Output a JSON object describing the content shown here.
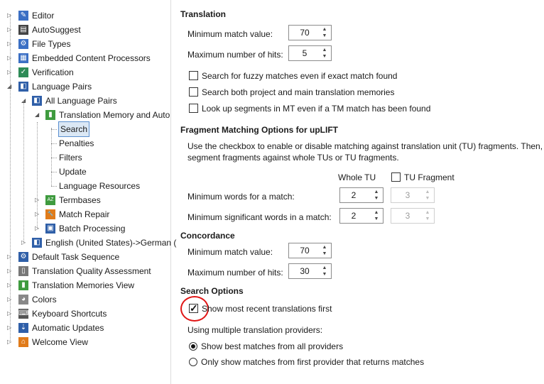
{
  "tree": {
    "items": [
      {
        "label": "Editor",
        "icon": "pencil-icon",
        "color": "#3b6fc4",
        "glyph": "✎"
      },
      {
        "label": "AutoSuggest",
        "icon": "autosuggest-icon",
        "color": "#444444",
        "glyph": "▤"
      },
      {
        "label": "File Types",
        "icon": "file-types-icon",
        "color": "#3b6fc4",
        "glyph": "⚙"
      },
      {
        "label": "Embedded Content Processors",
        "icon": "embedded-content-icon",
        "color": "#3b6fc4",
        "glyph": "▦"
      },
      {
        "label": "Verification",
        "icon": "verification-icon",
        "color": "#2e8b57",
        "glyph": "✓"
      },
      {
        "label": "Language Pairs",
        "icon": "language-pairs-icon",
        "color": "#2f5fa8",
        "glyph": "◧"
      },
      {
        "label": "All Language Pairs",
        "icon": "all-language-pairs-icon",
        "color": "#2f5fa8",
        "glyph": "◧"
      },
      {
        "label": "Translation Memory and Auto",
        "icon": "translation-memory-icon",
        "color": "#3f9b3f",
        "glyph": "▮"
      },
      {
        "label": "Search"
      },
      {
        "label": "Penalties"
      },
      {
        "label": "Filters"
      },
      {
        "label": "Update"
      },
      {
        "label": "Language Resources"
      },
      {
        "label": "Termbases",
        "icon": "termbases-icon",
        "color": "#3f9b3f",
        "glyph": "AZ"
      },
      {
        "label": "Match Repair",
        "icon": "wrench-icon",
        "color": "#e07b1a",
        "glyph": "🔧"
      },
      {
        "label": "Batch Processing",
        "icon": "batch-processing-icon",
        "color": "#2f5fa8",
        "glyph": "▣"
      },
      {
        "label": "English (United States)->German (",
        "icon": "language-pair-icon",
        "color": "#2f5fa8",
        "glyph": "◧"
      },
      {
        "label": "Default Task Sequence",
        "icon": "task-sequence-icon",
        "color": "#2f5fa8",
        "glyph": "⚙"
      },
      {
        "label": "Translation Quality Assessment",
        "icon": "quality-assessment-icon",
        "color": "#777777",
        "glyph": "▯"
      },
      {
        "label": "Translation Memories View",
        "icon": "tm-view-icon",
        "color": "#3f9b3f",
        "glyph": "▮"
      },
      {
        "label": "Colors",
        "icon": "palette-icon",
        "color": "#888888",
        "glyph": "◕"
      },
      {
        "label": "Keyboard Shortcuts",
        "icon": "keyboard-icon",
        "color": "#555555",
        "glyph": "⌨"
      },
      {
        "label": "Automatic Updates",
        "icon": "automatic-updates-icon",
        "color": "#2f5fa8",
        "glyph": "⇣"
      },
      {
        "label": "Welcome View",
        "icon": "home-icon",
        "color": "#e07b1a",
        "glyph": "⌂"
      }
    ]
  },
  "translation": {
    "header": "Translation",
    "min_match_label": "Minimum match value:",
    "min_match_value": "70",
    "max_hits_label": "Maximum number of hits:",
    "max_hits_value": "5",
    "fuzzy_label": "Search for fuzzy matches even if exact match found",
    "both_label": "Search both project and main translation memories",
    "mt_label": "Look up segments in MT even if a TM match has been found"
  },
  "fragment": {
    "header": "Fragment Matching Options for upLIFT",
    "desc_line1": "Use the checkbox to enable or disable matching against translation unit (TU)  fragments. Then, set the n",
    "desc_line2": "segment fragments against whole TUs or TU fragments.",
    "whole_tu": "Whole TU",
    "tu_fragment": "TU Fragment",
    "min_words_label": "Minimum words for a match:",
    "min_words_whole": "2",
    "min_words_frag": "3",
    "min_sig_label": "Minimum significant words in a match:",
    "min_sig_whole": "2",
    "min_sig_frag": "3"
  },
  "concordance": {
    "header": "Concordance",
    "min_match_label": "Minimum match value:",
    "min_match_value": "70",
    "max_hits_label": "Maximum number of hits:",
    "max_hits_value": "30"
  },
  "search_options": {
    "header": "Search Options",
    "recent_label": "Show most recent translations first",
    "multi_label": "Using multiple translation providers:",
    "radio_best": "Show best matches from all providers",
    "radio_first": "Only show matches from first provider that returns matches"
  },
  "colors": {
    "selection_bg": "#dbe8f5",
    "annotation_red": "#e01515"
  }
}
